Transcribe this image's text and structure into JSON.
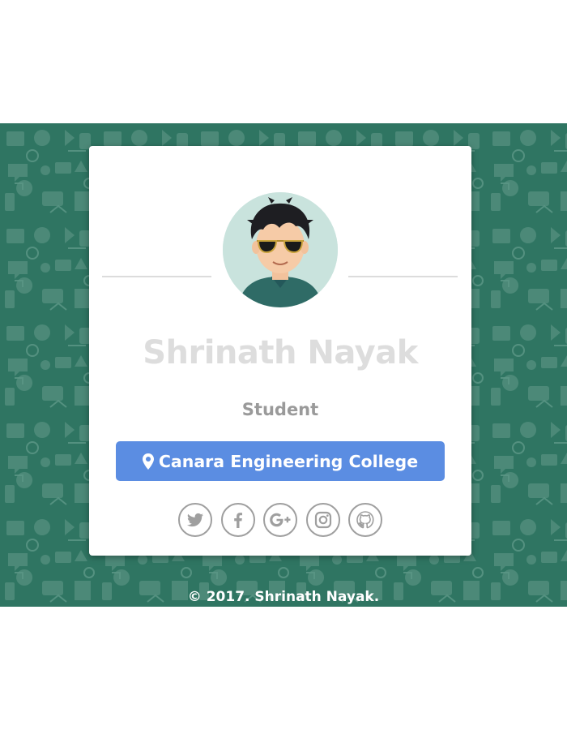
{
  "profile": {
    "name": "Shrinath Nayak",
    "role": "Student",
    "location": "Canara Engineering College"
  },
  "socials": [
    {
      "icon": "twitter-icon"
    },
    {
      "icon": "facebook-icon"
    },
    {
      "icon": "google-plus-icon"
    },
    {
      "icon": "instagram-icon"
    },
    {
      "icon": "github-icon"
    }
  ],
  "footer": {
    "text": "© 2017. Shrinath Nayak."
  },
  "colors": {
    "background": "#2f7562",
    "card": "#ffffff",
    "location_button": "#5b8de2",
    "name_text": "#dddddd",
    "role_text": "#9a9a9a",
    "social_icon": "#9f9f9f"
  }
}
